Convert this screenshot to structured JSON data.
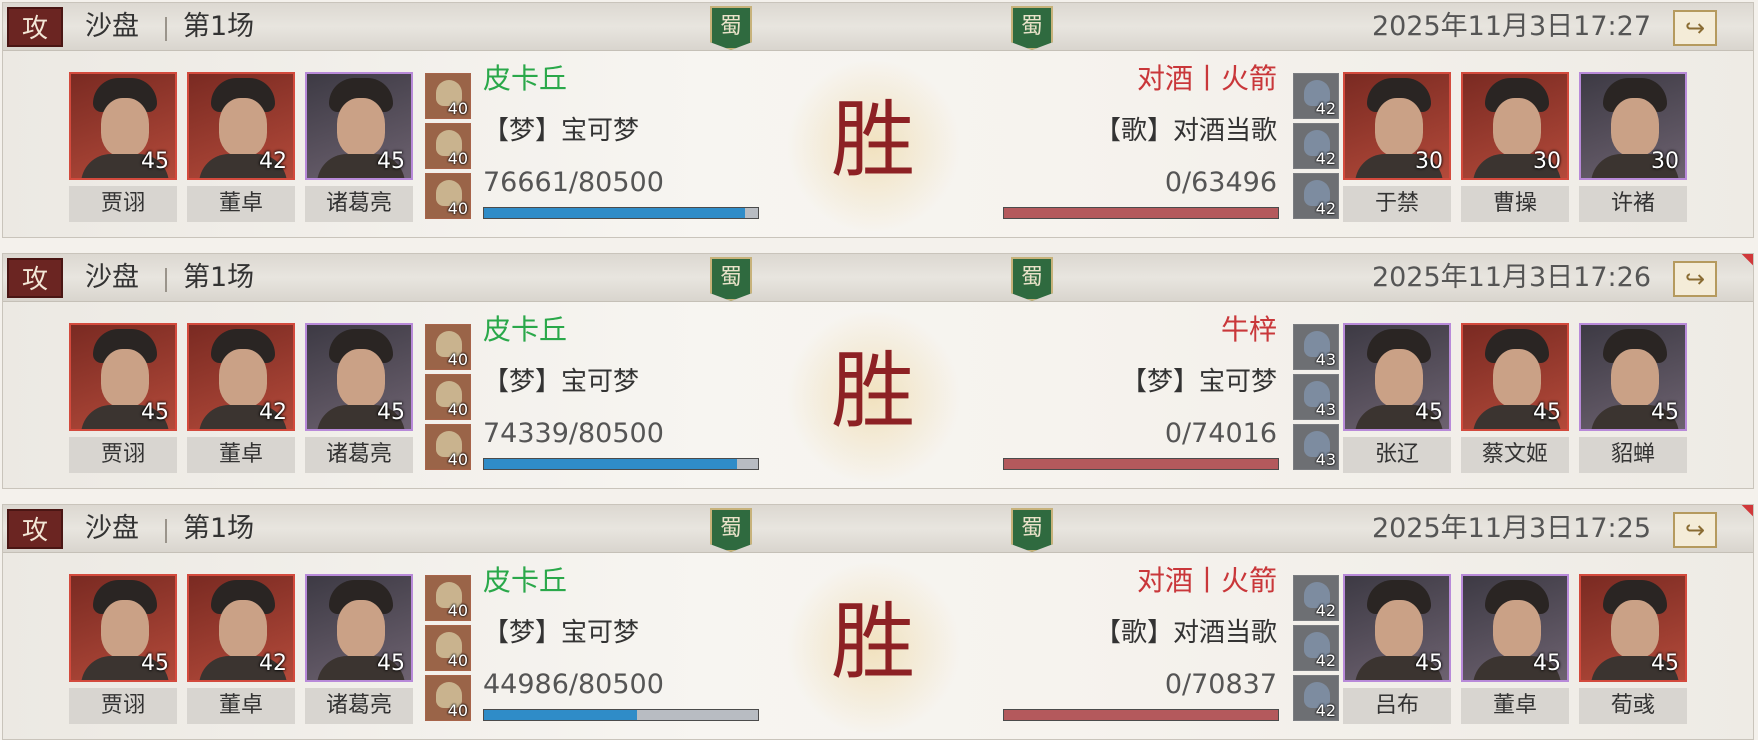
{
  "records": [
    {
      "attack_label": "攻",
      "mode": "沙盘",
      "round": "第1场",
      "banner_left": "蜀",
      "banner_right": "蜀",
      "time": "2025年11月3日17:27",
      "result": "胜",
      "left": {
        "player": "皮卡丘",
        "guild": "【梦】宝可梦",
        "hp_text": "76661/80500",
        "hp_fraction": 0.952,
        "heroes": [
          {
            "name": "贾诩",
            "level": "45",
            "frame": "red"
          },
          {
            "name": "董卓",
            "level": "42",
            "frame": "red"
          },
          {
            "name": "诸葛亮",
            "level": "45",
            "frame": "purple"
          }
        ],
        "troops": [
          "40",
          "40",
          "40"
        ]
      },
      "right": {
        "player": "对酒丨火箭",
        "guild": "【歌】对酒当歌",
        "hp_text": "0/63496",
        "hp_fraction": 1.0,
        "heroes": [
          {
            "name": "于禁",
            "level": "30",
            "frame": "red"
          },
          {
            "name": "曹操",
            "level": "30",
            "frame": "red"
          },
          {
            "name": "许褚",
            "level": "30",
            "frame": "purple"
          }
        ],
        "troops": [
          "42",
          "42",
          "42"
        ]
      }
    },
    {
      "attack_label": "攻",
      "mode": "沙盘",
      "round": "第1场",
      "banner_left": "蜀",
      "banner_right": "蜀",
      "time": "2025年11月3日17:26",
      "result": "胜",
      "left": {
        "player": "皮卡丘",
        "guild": "【梦】宝可梦",
        "hp_text": "74339/80500",
        "hp_fraction": 0.923,
        "heroes": [
          {
            "name": "贾诩",
            "level": "45",
            "frame": "red"
          },
          {
            "name": "董卓",
            "level": "42",
            "frame": "red"
          },
          {
            "name": "诸葛亮",
            "level": "45",
            "frame": "purple"
          }
        ],
        "troops": [
          "40",
          "40",
          "40"
        ]
      },
      "right": {
        "player": "牛梓",
        "guild": "【梦】宝可梦",
        "hp_text": "0/74016",
        "hp_fraction": 1.0,
        "heroes": [
          {
            "name": "张辽",
            "level": "45",
            "frame": "purple"
          },
          {
            "name": "蔡文姬",
            "level": "45",
            "frame": "red"
          },
          {
            "name": "貂蝉",
            "level": "45",
            "frame": "purple"
          }
        ],
        "troops": [
          "43",
          "43",
          "43"
        ]
      }
    },
    {
      "attack_label": "攻",
      "mode": "沙盘",
      "round": "第1场",
      "banner_left": "蜀",
      "banner_right": "蜀",
      "time": "2025年11月3日17:25",
      "result": "胜",
      "left": {
        "player": "皮卡丘",
        "guild": "【梦】宝可梦",
        "hp_text": "44986/80500",
        "hp_fraction": 0.559,
        "heroes": [
          {
            "name": "贾诩",
            "level": "45",
            "frame": "red"
          },
          {
            "name": "董卓",
            "level": "42",
            "frame": "red"
          },
          {
            "name": "诸葛亮",
            "level": "45",
            "frame": "purple"
          }
        ],
        "troops": [
          "40",
          "40",
          "40"
        ]
      },
      "right": {
        "player": "对酒丨火箭",
        "guild": "【歌】对酒当歌",
        "hp_text": "0/70837",
        "hp_fraction": 1.0,
        "heroes": [
          {
            "name": "吕布",
            "level": "45",
            "frame": "purple"
          },
          {
            "name": "董卓",
            "level": "45",
            "frame": "purple"
          },
          {
            "name": "荀彧",
            "level": "45",
            "frame": "red"
          }
        ],
        "troops": [
          "42",
          "42",
          "42"
        ]
      }
    }
  ],
  "colors": {
    "left_player": "#2aa84a",
    "right_player": "#c9373a",
    "result": "#8d2124"
  },
  "icons": {
    "share": "share-icon",
    "attack": "attack-badge",
    "banner": "shu-banner-icon"
  }
}
